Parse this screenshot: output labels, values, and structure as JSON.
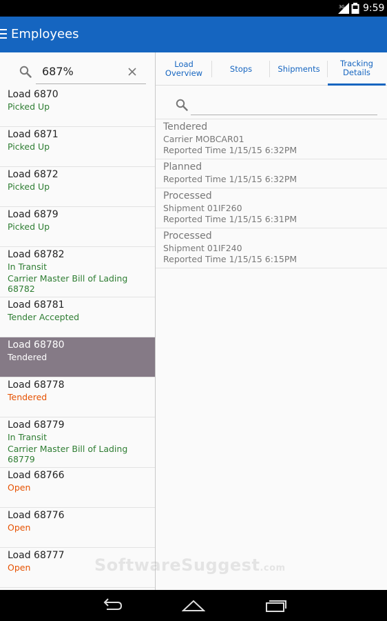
{
  "status_bar": {
    "network": "3G",
    "time": "9:59"
  },
  "app_bar": {
    "title": "Employees"
  },
  "left_search": {
    "query": "687%"
  },
  "loads": [
    {
      "name": "Load 6870",
      "status": "Picked Up",
      "status_color": "green"
    },
    {
      "name": "Load 6871",
      "status": "Picked Up",
      "status_color": "green"
    },
    {
      "name": "Load 6872",
      "status": "Picked Up",
      "status_color": "green"
    },
    {
      "name": "Load 6879",
      "status": "Picked Up",
      "status_color": "green"
    },
    {
      "name": "Load 68782",
      "status": "In Transit",
      "status_color": "green",
      "detail_1": "Carrier Master Bill of Lading",
      "detail_2": "68782"
    },
    {
      "name": "Load 68781",
      "status": "Tender Accepted",
      "status_color": "green"
    },
    {
      "name": "Load 68780",
      "status": "Tendered",
      "status_color": "white",
      "selected": true
    },
    {
      "name": "Load 68778",
      "status": "Tendered",
      "status_color": "orange"
    },
    {
      "name": "Load 68779",
      "status": "In Transit",
      "status_color": "green",
      "detail_1": "Carrier Master Bill of Lading",
      "detail_2": "68779"
    },
    {
      "name": "Load 68766",
      "status": "Open",
      "status_color": "orange"
    },
    {
      "name": "Load 68776",
      "status": "Open",
      "status_color": "orange"
    },
    {
      "name": "Load 68777",
      "status": "Open",
      "status_color": "orange"
    }
  ],
  "tabs": [
    {
      "line1": "Load",
      "line2": "Overview",
      "active": false
    },
    {
      "line1": "Stops",
      "line2": "",
      "active": false
    },
    {
      "line1": "Shipments",
      "line2": "",
      "active": false
    },
    {
      "line1": "Tracking",
      "line2": "Details",
      "active": true
    }
  ],
  "right_search": {
    "value": ""
  },
  "tracking": [
    {
      "status": "Tendered",
      "line1": "Carrier MOBCAR01",
      "line2": "Reported Time 1/15/15 6:32PM"
    },
    {
      "status": "Planned",
      "line1": "Reported Time 1/15/15 6:32PM",
      "line2": ""
    },
    {
      "status": "Processed",
      "line1": "Shipment 01IF260",
      "line2": "Reported Time 1/15/15 6:31PM"
    },
    {
      "status": "Processed",
      "line1": "Shipment 01IF240",
      "line2": "Reported Time 1/15/15 6:15PM"
    }
  ],
  "watermark": {
    "brand": "SoftwareSuggest",
    "suffix": ".com"
  },
  "colors": {
    "app_bar": "#1565c0",
    "selected_row": "#857a86",
    "status_green": "#2e7d32",
    "status_orange": "#e65100"
  },
  "icons": {
    "menu": "hamburger-icon",
    "search": "search-icon",
    "clear": "close-icon",
    "back": "back-icon",
    "home": "home-icon",
    "recents": "recents-icon"
  }
}
